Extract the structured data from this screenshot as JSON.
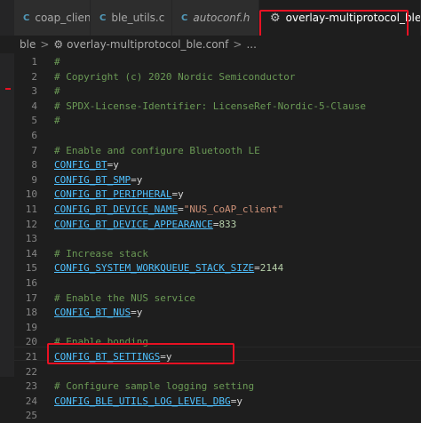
{
  "tabs": [
    {
      "icon": "C",
      "label": "coap_client.c",
      "active": false,
      "italic": false
    },
    {
      "icon": "C",
      "label": "ble_utils.c",
      "active": false,
      "italic": false
    },
    {
      "icon": "C",
      "label": "autoconf.h",
      "active": false,
      "italic": true
    },
    {
      "icon": "gear-icon",
      "label": "overlay-multiprotocol_ble.conf",
      "active": true,
      "italic": false
    }
  ],
  "breadcrumb": {
    "folder": "ble",
    "separator": ">",
    "file": "overlay-multiprotocol_ble.conf",
    "more": "..."
  },
  "editor": {
    "lines": [
      {
        "n": "1",
        "text": "#"
      },
      {
        "n": "2",
        "text": "# Copyright (c) 2020 Nordic Semiconductor"
      },
      {
        "n": "3",
        "text": "#"
      },
      {
        "n": "4",
        "text": "# SPDX-License-Identifier: LicenseRef-Nordic-5-Clause"
      },
      {
        "n": "5",
        "text": "#"
      },
      {
        "n": "6",
        "text": ""
      },
      {
        "n": "7",
        "text": "# Enable and configure Bluetooth LE"
      },
      {
        "n": "8",
        "key": "CONFIG_BT",
        "eq": "=",
        "value": "y"
      },
      {
        "n": "9",
        "key": "CONFIG_BT_SMP",
        "eq": "=",
        "value": "y"
      },
      {
        "n": "10",
        "key": "CONFIG_BT_PERIPHERAL",
        "eq": "=",
        "value": "y"
      },
      {
        "n": "11",
        "key": "CONFIG_BT_DEVICE_NAME",
        "eq": "=",
        "value": "\"NUS_CoAP_client\""
      },
      {
        "n": "12",
        "key": "CONFIG_BT_DEVICE_APPEARANCE",
        "eq": "=",
        "value": "833"
      },
      {
        "n": "13",
        "text": ""
      },
      {
        "n": "14",
        "text": "# Increase stack"
      },
      {
        "n": "15",
        "key": "CONFIG_SYSTEM_WORKQUEUE_STACK_SIZE",
        "eq": "=",
        "value": "2144"
      },
      {
        "n": "16",
        "text": ""
      },
      {
        "n": "17",
        "text": "# Enable the NUS service"
      },
      {
        "n": "18",
        "key": "CONFIG_BT_NUS",
        "eq": "=",
        "value": "y"
      },
      {
        "n": "19",
        "text": ""
      },
      {
        "n": "20",
        "text": "# Enable bonding"
      },
      {
        "n": "21",
        "key": "CONFIG_BT_SETTINGS",
        "eq": "=",
        "value": "y"
      },
      {
        "n": "22",
        "text": ""
      },
      {
        "n": "23",
        "text": "# Configure sample logging setting"
      },
      {
        "n": "24",
        "key": "CONFIG_BLE_UTILS_LOG_LEVEL_DBG",
        "eq": "=",
        "value": "y"
      },
      {
        "n": "25",
        "text": ""
      }
    ]
  }
}
